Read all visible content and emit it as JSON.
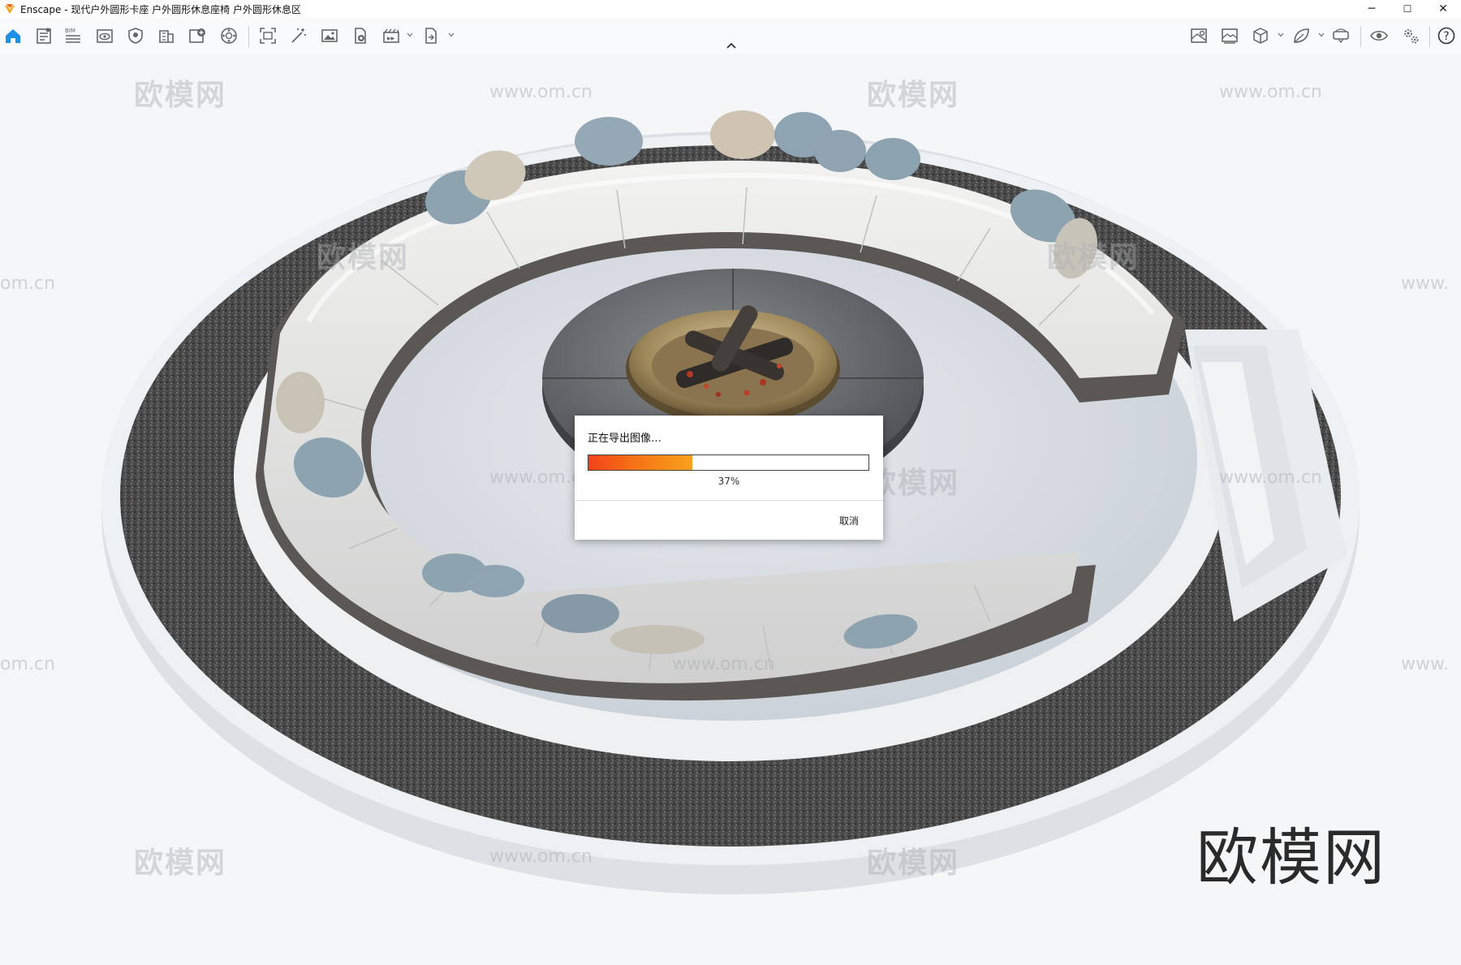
{
  "window": {
    "title": "Enscape - 现代户外圆形卡座 户外圆形休息座椅 户外圆形休息区",
    "controls": {
      "minimize": "─",
      "maximize": "☐",
      "close": "✕"
    }
  },
  "toolbar": {
    "left_icons": [
      "home-icon",
      "document-icon",
      "bim-icon",
      "view-icon",
      "shield-icon",
      "building-icon",
      "add-view-icon",
      "sphere-icon",
      "screenshot-icon",
      "magic-wand-icon",
      "image-icon",
      "file-export-icon",
      "video-icon",
      "export-icon"
    ],
    "right_icons": [
      "map-icon",
      "gallery-icon",
      "cube-icon",
      "leaf-icon",
      "vr-headset-icon",
      "eye-icon",
      "settings-icon",
      "help-icon"
    ],
    "bim_label": "BIM",
    "help_label": "?"
  },
  "dialog": {
    "title": "正在导出图像…",
    "progress_percent": 37,
    "progress_label": "37%",
    "cancel_label": "取消"
  },
  "watermarks": {
    "brand": "欧模网",
    "url": "www.om.cn",
    "url_short": "om.cn",
    "url_partial": "www."
  },
  "colors": {
    "progress_start": "#f2421b",
    "progress_end": "#f7a21c",
    "accent": "#1e90e6"
  }
}
